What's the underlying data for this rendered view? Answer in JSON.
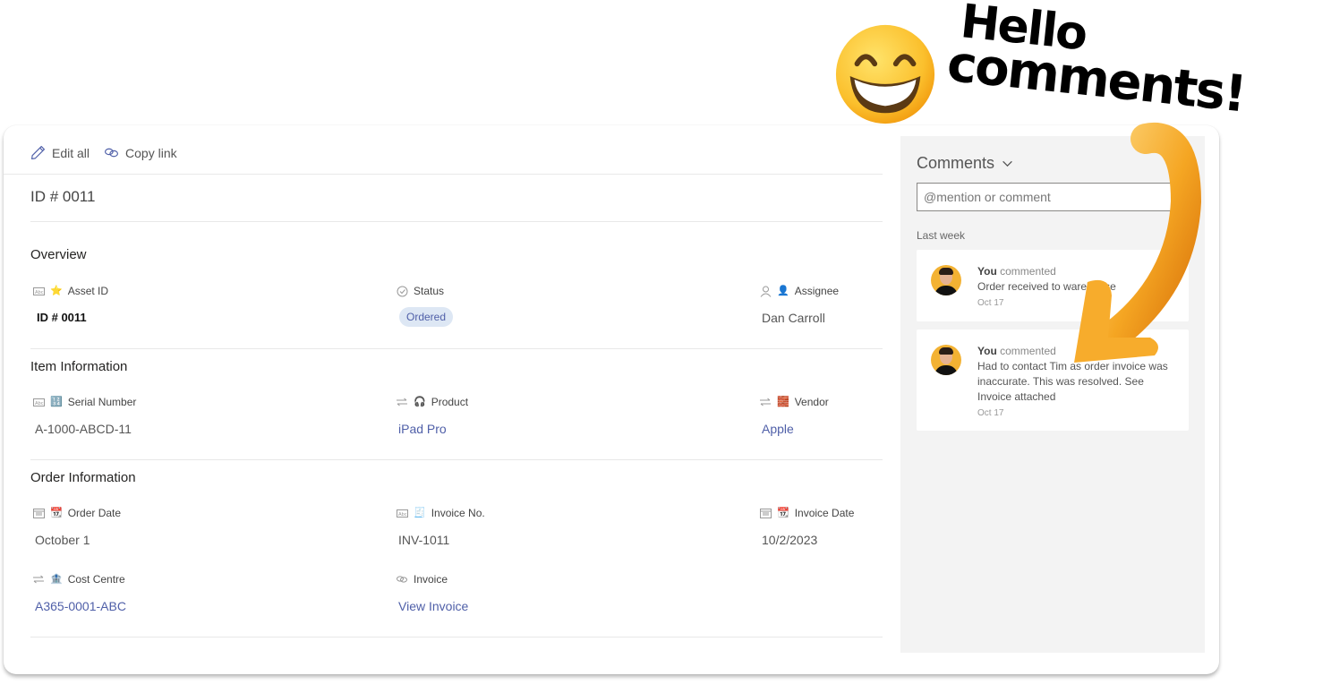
{
  "banner": {
    "line1": "Hello",
    "line2": "comments!",
    "emoji_icon": "grinning-smiling-eyes-emoji",
    "arrow_icon": "curved-arrow-down-left"
  },
  "toolbar": {
    "edit_all": "Edit all",
    "copy_link": "Copy link"
  },
  "record": {
    "title": "ID # 0011"
  },
  "sections": {
    "overview": {
      "title": "Overview",
      "fields": {
        "asset_id": {
          "type_icon": "text-field-icon",
          "emoji": "⭐",
          "label": "Asset ID",
          "value": "ID # 0011"
        },
        "status": {
          "type_icon": "choice-check-icon",
          "label": "Status",
          "value": "Ordered"
        },
        "assignee": {
          "type_icon": "person-icon",
          "emoji": "👤",
          "label": "Assignee",
          "value": "Dan Carroll"
        }
      }
    },
    "item": {
      "title": "Item Information",
      "fields": {
        "serial_number": {
          "type_icon": "text-field-icon",
          "emoji": "🔢",
          "label": "Serial Number",
          "value": "A-1000-ABCD-11"
        },
        "product": {
          "type_icon": "lookup-icon",
          "emoji": "🎧",
          "label": "Product",
          "value": "iPad Pro"
        },
        "vendor": {
          "type_icon": "lookup-icon",
          "emoji": "🧱",
          "label": "Vendor",
          "value": "Apple"
        }
      }
    },
    "order": {
      "title": "Order Information",
      "fields": {
        "order_date": {
          "type_icon": "calendar-icon",
          "emoji": "📆",
          "label": "Order Date",
          "value": "October 1"
        },
        "invoice_no": {
          "type_icon": "text-field-icon",
          "emoji": "🧾",
          "label": "Invoice No.",
          "value": "INV-1011"
        },
        "invoice_date": {
          "type_icon": "calendar-icon",
          "emoji": "📆",
          "label": "Invoice Date",
          "value": "10/2/2023"
        },
        "cost_centre": {
          "type_icon": "lookup-icon",
          "emoji": "🏦",
          "label": "Cost Centre",
          "value": "A365-0001-ABC"
        },
        "invoice": {
          "type_icon": "link-icon",
          "label": "Invoice",
          "value": "View Invoice"
        }
      }
    }
  },
  "comments": {
    "title": "Comments",
    "input_placeholder": "@mention or comment",
    "group_label": "Last week",
    "items": [
      {
        "author": "You",
        "action": "commented",
        "text": "Order received to warehouse",
        "date": "Oct 17"
      },
      {
        "author": "You",
        "action": "commented",
        "text": "Had to contact Tim as order invoice was inaccurate. This was resolved. See Invoice attached",
        "date": "Oct 17"
      }
    ]
  },
  "colors": {
    "link": "#4f5fa8",
    "status_pill_bg": "#dde7f4",
    "comments_bg": "#f3f3f3",
    "arrow": "#f5a623",
    "avatar_bg": "#f3b233"
  }
}
